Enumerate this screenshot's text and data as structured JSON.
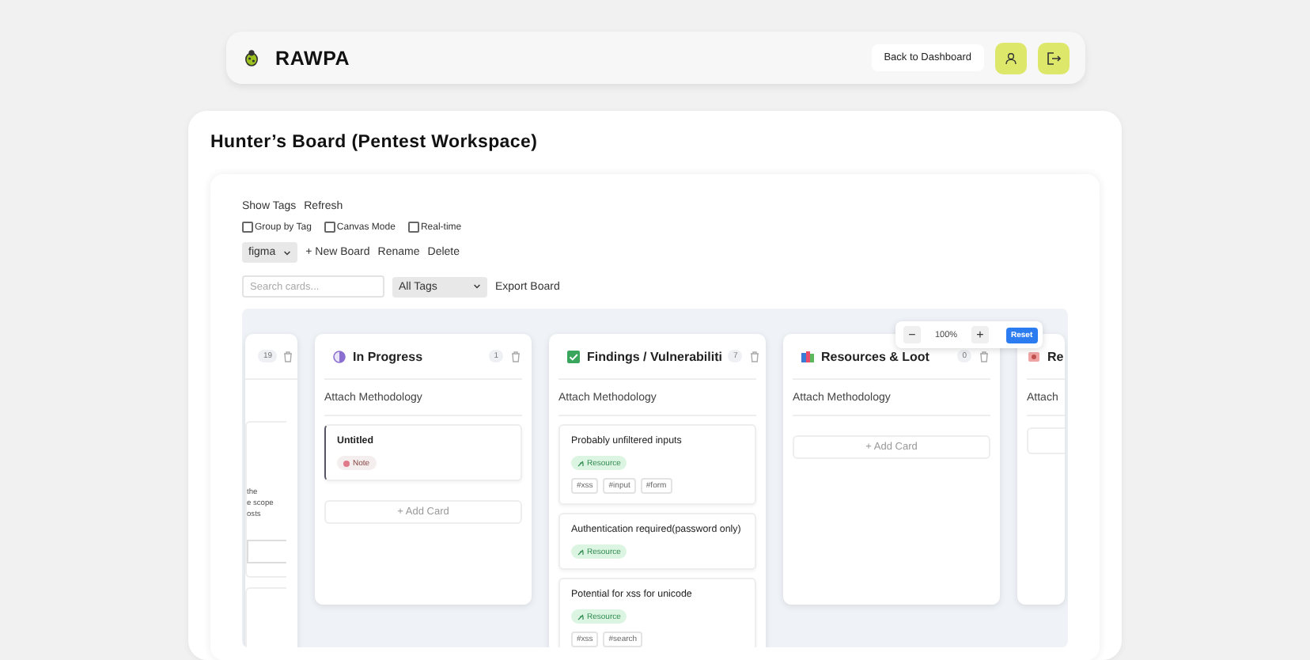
{
  "header": {
    "brand": "RAWPA",
    "back_button": "Back to Dashboard"
  },
  "page_title": "Hunter’s Board (Pentest Workspace)",
  "toolbar": {
    "links": [
      "Show Tags",
      "Refresh"
    ],
    "checkboxes": [
      {
        "label": "Group by Tag",
        "checked": false
      },
      {
        "label": "Canvas Mode",
        "checked": false
      },
      {
        "label": "Real-time",
        "checked": false
      }
    ],
    "board_select": "figma",
    "board_actions": [
      "+ New Board",
      "Rename",
      "Delete"
    ],
    "search": {
      "placeholder": "Search cards..."
    },
    "tag_filter": "All Tags",
    "export": "Export Board"
  },
  "zoom": {
    "minus": "−",
    "value": "100%",
    "plus": "+",
    "reset": "Reset"
  },
  "columns": [
    {
      "kind": "stub",
      "count": "19",
      "snippet": [
        "the",
        "e scope",
        "osts"
      ]
    },
    {
      "kind": "progress",
      "title": "In Progress",
      "count": "1",
      "subtitle": "Attach Methodology",
      "add_label": "+ Add Card",
      "cards": [
        {
          "kind": "note",
          "title": "Untitled",
          "badge": "Note"
        }
      ]
    },
    {
      "kind": "findings",
      "title": "Findings / Vulnerabiliti",
      "count": "7",
      "subtitle": "Attach Methodology",
      "cards": [
        {
          "kind": "resource",
          "title": "Probably unfiltered inputs",
          "badge": "Resource",
          "hashtags": [
            "#xss",
            "#input",
            "#form"
          ]
        },
        {
          "kind": "resource",
          "title": "Authentication required(password only)",
          "badge": "Resource"
        },
        {
          "kind": "resource",
          "title": "Potential for xss for unicode",
          "badge": "Resource",
          "hashtags": [
            "#xss",
            "#search"
          ]
        }
      ]
    },
    {
      "kind": "resources",
      "title": "Resources & Loot",
      "count": "0",
      "subtitle": "Attach Methodology",
      "add_label": "+ Add Card"
    },
    {
      "kind": "peek",
      "title": "Re",
      "subtitle": "Attach"
    }
  ]
}
